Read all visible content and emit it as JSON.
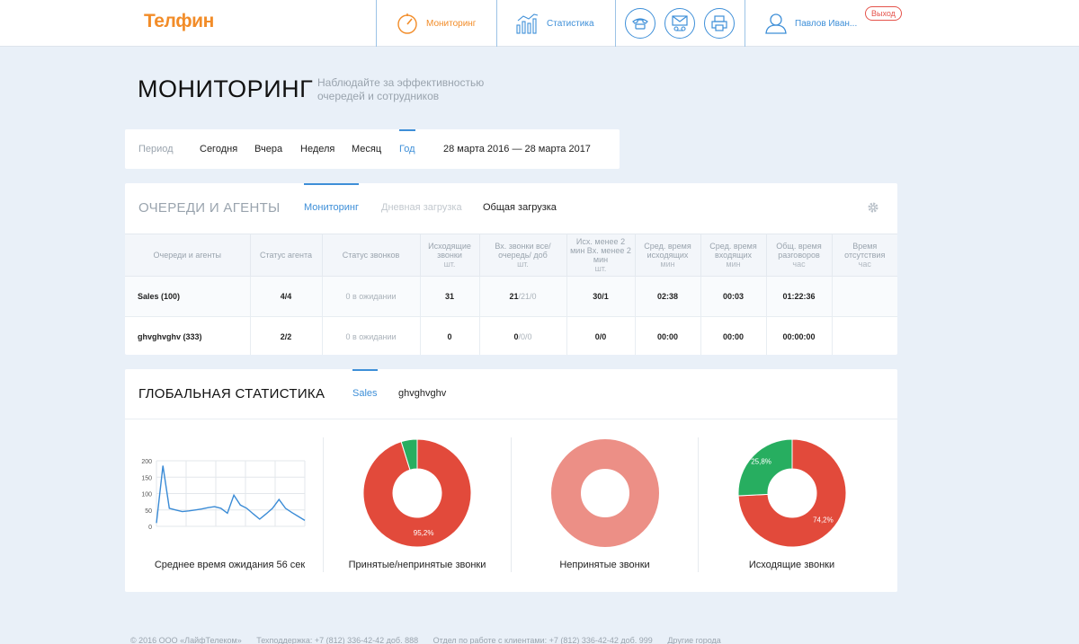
{
  "header": {
    "logo": "Телфин",
    "nav": [
      {
        "label": "Мониторинг",
        "icon": "gauge-icon"
      },
      {
        "label": "Статистика",
        "icon": "bar-chart-icon"
      }
    ],
    "round_buttons": [
      "phone-icon",
      "voicemail-icon",
      "fax-icon"
    ],
    "user_name": "Павлов Иван...",
    "logout_label": "Выход"
  },
  "page": {
    "title": "МОНИТОРИНГ",
    "subtitle": "Наблюдайте за эффективностью очередей и сотрудников"
  },
  "period": {
    "label": "Период",
    "options": [
      "Сегодня",
      "Вчера",
      "Неделя",
      "Месяц",
      "Год"
    ],
    "selected": "Год",
    "range": "28 марта 2016 — 28 марта 2017"
  },
  "queues": {
    "title": "ОЧЕРЕДИ И АГЕНТЫ",
    "tabs": [
      "Мониторинг",
      "Дневная загрузка",
      "Общая загрузка"
    ],
    "columns": [
      {
        "title": "Очереди и агенты",
        "unit": ""
      },
      {
        "title": "Статус агента",
        "unit": ""
      },
      {
        "title": "Статус звонков",
        "unit": ""
      },
      {
        "title": "Исходящие звонки",
        "unit": "шт."
      },
      {
        "title": "Вх. звонки все/ очередь/ доб",
        "unit": "шт."
      },
      {
        "title": "Исх. менее 2 мин Вх. менее 2 мин",
        "unit": "шт."
      },
      {
        "title": "Сред. время исходящих",
        "unit": "мин"
      },
      {
        "title": "Сред. время входящих",
        "unit": "мин"
      },
      {
        "title": "Общ. время разговоров",
        "unit": "час"
      },
      {
        "title": "Время отсутствия",
        "unit": "час"
      }
    ],
    "rows": [
      {
        "name": "Sales (100)",
        "agent_status": "4/4",
        "call_status": "0 в ожидании",
        "outgoing": "31",
        "incoming_all": "21",
        "incoming_rest": "/21/0",
        "short_calls": "30/1",
        "avg_out": "02:38",
        "avg_in": "00:03",
        "total_talk": "01:22:36",
        "absence": ""
      },
      {
        "name": "ghvghvghv (333)",
        "agent_status": "2/2",
        "call_status": "0 в ожидании",
        "outgoing": "0",
        "incoming_all": "0",
        "incoming_rest": "/0/0",
        "short_calls": "0/0",
        "avg_out": "00:00",
        "avg_in": "00:00",
        "total_talk": "00:00:00",
        "absence": ""
      }
    ]
  },
  "global": {
    "title": "ГЛОБАЛЬНАЯ СТАТИСТИКА",
    "tabs": [
      "Sales",
      "ghvghvghv"
    ],
    "captions": [
      "Среднее время ожидания 56 сек",
      "Принятые/непринятые звонки",
      "Непринятые звонки",
      "Исходящие звонки"
    ]
  },
  "chart_data": [
    {
      "type": "line",
      "title": "",
      "y_ticks": [
        "0",
        "50",
        "100",
        "150",
        "200"
      ],
      "ylim": [
        0,
        200
      ],
      "grid": true,
      "series": [
        {
          "values": [
            10,
            185,
            55,
            50,
            45,
            47,
            50,
            53,
            57,
            60,
            55,
            40,
            95,
            65,
            55,
            38,
            22,
            38,
            55,
            82,
            55,
            42,
            30,
            18
          ]
        }
      ],
      "color": "#3a8bd6"
    },
    {
      "type": "pie",
      "donut": true,
      "slices": [
        {
          "value": 95.2,
          "label": "95,2%",
          "color": "#e24a3b"
        },
        {
          "value": 4.8,
          "label": "",
          "color": "#27ae60"
        }
      ]
    },
    {
      "type": "pie",
      "donut": true,
      "slices": [
        {
          "value": 100,
          "label": "",
          "color": "#ec8f86"
        }
      ]
    },
    {
      "type": "pie",
      "donut": true,
      "slices": [
        {
          "value": 74.2,
          "label": "74,2%",
          "color": "#e24a3b"
        },
        {
          "value": 25.8,
          "label": "25,8%",
          "color": "#27ae60"
        }
      ]
    }
  ],
  "footer": [
    "© 2016 ООО «ЛайфТелеком»",
    "Техподдержка: +7 (812) 336-42-42 доб. 888",
    "Отдел по работе с клиентами: +7 (812) 336-42-42 доб. 999",
    "Другие города"
  ]
}
